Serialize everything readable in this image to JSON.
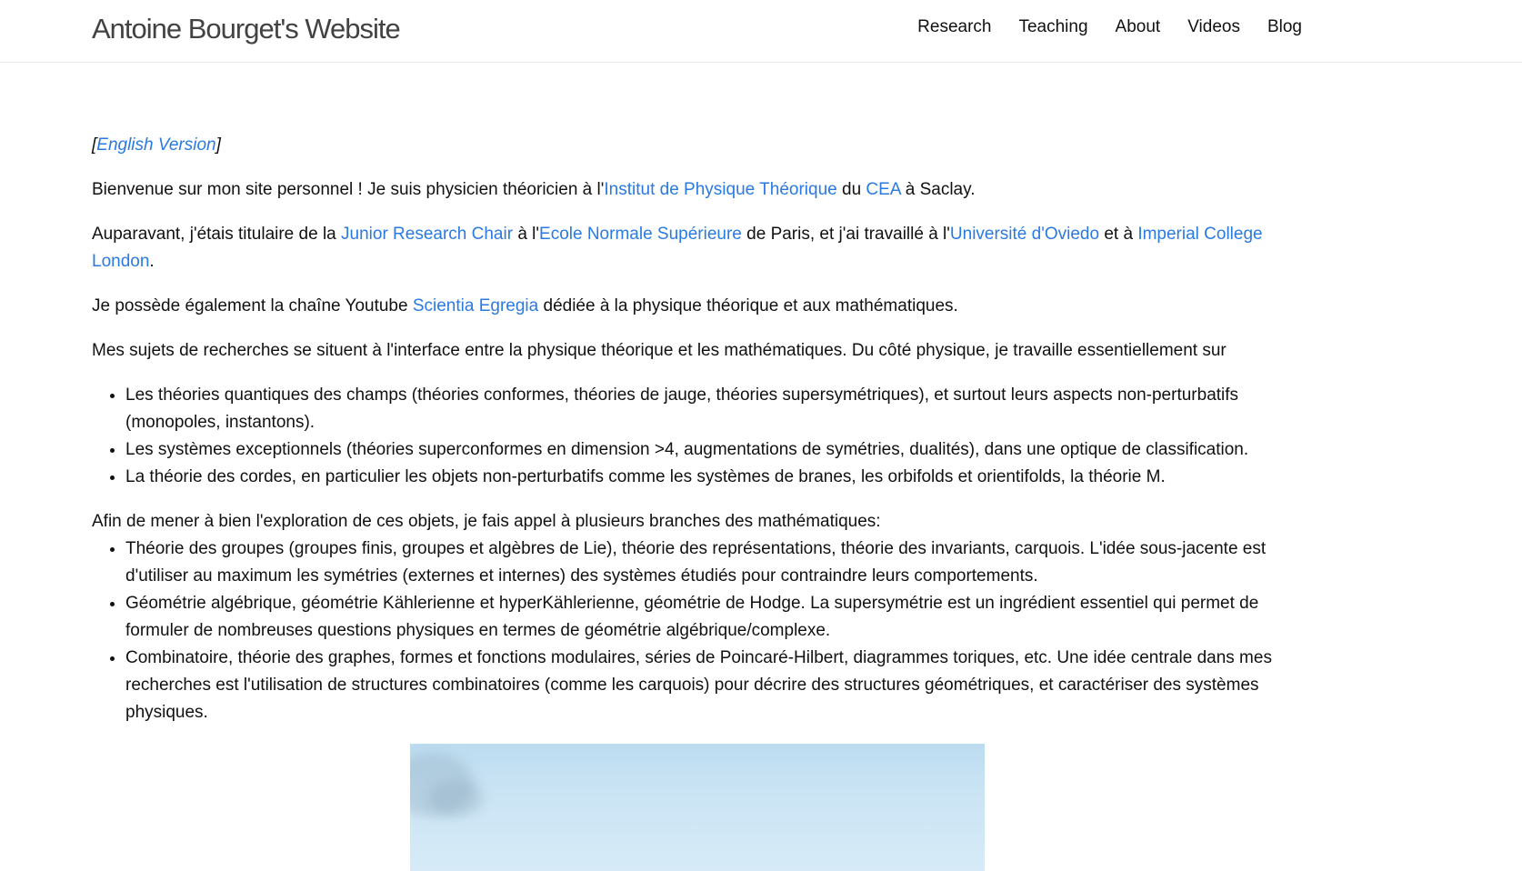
{
  "header": {
    "site_title": "Antoine Bourget's Website",
    "nav": [
      {
        "label": "Research"
      },
      {
        "label": "Teaching"
      },
      {
        "label": "About"
      },
      {
        "label": "Videos"
      },
      {
        "label": "Blog"
      }
    ]
  },
  "content": {
    "lang": {
      "open": "[",
      "link": "English Version",
      "close": "]"
    },
    "p1": {
      "t1": "Bienvenue sur mon site personnel ! Je suis physicien théoricien à l'",
      "link1": "Institut de Physique Théorique",
      "t2": " du ",
      "link2": "CEA",
      "t3": " à Saclay."
    },
    "p2": {
      "t1": "Auparavant, j'étais titulaire de la ",
      "link1": "Junior Research Chair",
      "t2": " à l'",
      "link2": "Ecole Normale Supérieure",
      "t3": " de Paris, et j'ai travaillé à l'",
      "link3": "Université d'Oviedo",
      "t4": " et à ",
      "link4": "Imperial College London",
      "t5": "."
    },
    "p3": {
      "t1": "Je possède également la chaîne Youtube ",
      "link1": "Scientia Egregia",
      "t2": " dédiée à la physique théorique et aux mathématiques."
    },
    "p4": "Mes sujets de recherches se situent à l'interface entre la physique théorique et les mathématiques. Du côté physique, je travaille essentiellement sur",
    "physics_list": [
      "Les théories quantiques des champs (théories conformes, théories de jauge, théories supersymétriques), et surtout leurs aspects non-perturbatifs (monopoles, instantons).",
      "Les systèmes exceptionnels (théories superconformes en dimension >4, augmentations de symétries, dualités), dans une optique de classification.",
      "La théorie des cordes, en particulier les objets non-perturbatifs comme les systèmes de branes, les orbifolds et orientifolds, la théorie M."
    ],
    "p5": "Afin de mener à bien l'exploration de ces objets, je fais appel à plusieurs branches des mathématiques:",
    "math_list": [
      "Théorie des groupes (groupes finis, groupes et algèbres de Lie), théorie des représentations, théorie des invariants, carquois. L'idée sous-jacente est d'utiliser au maximum les symétries (externes et internes) des systèmes étudiés pour contraindre leurs comportements.",
      "Géométrie algébrique, géométrie Kählerienne et hyperKählerienne, géométrie de Hodge. La supersymétrie est un ingrédient essentiel qui permet de formuler de nombreuses questions physiques en termes de géométrie algébrique/complexe.",
      "Combinatoire, théorie des graphes, formes et fonctions modulaires, séries de Poincaré-Hilbert, diagrammes toriques, etc. Une idée centrale dans mes recherches est l'utilisation de structures combinatoires (comme les carquois) pour décrire des structures géométriques, et caractériser des systèmes physiques."
    ]
  },
  "colors": {
    "link": "#2a7ae2",
    "text": "#111111",
    "title": "#424242",
    "header_border": "#e8e8e8",
    "image_sky": "#cbe4f4"
  }
}
